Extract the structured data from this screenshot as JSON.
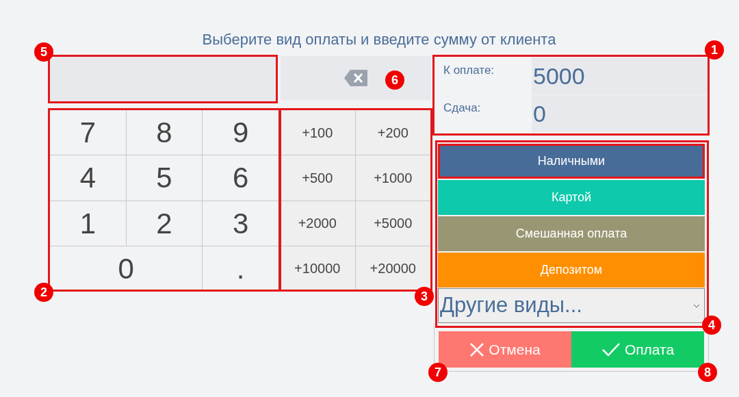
{
  "title": "Выберите вид оплаты и введите сумму от клиента",
  "numpad": [
    "7",
    "8",
    "9",
    "4",
    "5",
    "6",
    "1",
    "2",
    "3",
    "0",
    "."
  ],
  "quick_amounts": [
    "+100",
    "+200",
    "+500",
    "+1000",
    "+2000",
    "+5000",
    "+10000",
    "+20000"
  ],
  "summary": [
    {
      "label": "К оплате:",
      "value": "5000"
    },
    {
      "label": "Сдача:",
      "value": "0"
    }
  ],
  "payment_methods": [
    {
      "label": "Наличными",
      "color": "#486c98",
      "selected": true
    },
    {
      "label": "Картой",
      "color": "#0ec9ab",
      "selected": false
    },
    {
      "label": "Смешанная оплата",
      "color": "#999773",
      "selected": false
    },
    {
      "label": "Депозитом",
      "color": "#ff8f00",
      "selected": false
    }
  ],
  "other_methods": {
    "value": "Другие виды..."
  },
  "actions": [
    {
      "kind": "cancel",
      "label": "Отмена"
    },
    {
      "kind": "confirm",
      "label": "Оплата"
    }
  ],
  "callouts": [
    "1",
    "2",
    "3",
    "4",
    "5",
    "6",
    "7",
    "8"
  ]
}
